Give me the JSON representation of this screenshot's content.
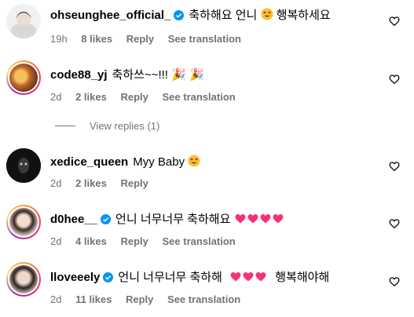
{
  "comments": [
    {
      "user": "ohseunghee_official_",
      "verified": true,
      "text": "축하해요 언니",
      "text_suffix": "행복하세요",
      "time": "19h",
      "likes": "8 likes",
      "reply": "Reply",
      "translation": "See translation"
    },
    {
      "user": "code88_yj",
      "verified": false,
      "text": "축하쓰~~!!! 🎉 🎉",
      "time": "2d",
      "likes": "2 likes",
      "reply": "Reply",
      "translation": "See translation"
    },
    {
      "user": "xedice_queen",
      "verified": false,
      "text": "Myy Baby",
      "time": "2d",
      "likes": "2 likes",
      "reply": "Reply"
    },
    {
      "user": "d0hee__",
      "verified": true,
      "text": "언니 너무너무 축하해요",
      "time": "2d",
      "likes": "4 likes",
      "reply": "Reply",
      "translation": "See translation"
    },
    {
      "user": "lloveeely",
      "verified": true,
      "text": "언니 너무너무 축하해",
      "text_suffix": "행복해야해",
      "time": "2d",
      "likes": "11 likes",
      "reply": "Reply",
      "translation": "See translation"
    }
  ],
  "view_replies": "View replies (1)",
  "colors": {
    "verified_blue": "#0095f6",
    "secondary_text": "#737373",
    "heart_pink": "#f7307a"
  },
  "icons": {
    "like": "heart-outline-icon",
    "verified": "verified-badge-icon"
  }
}
